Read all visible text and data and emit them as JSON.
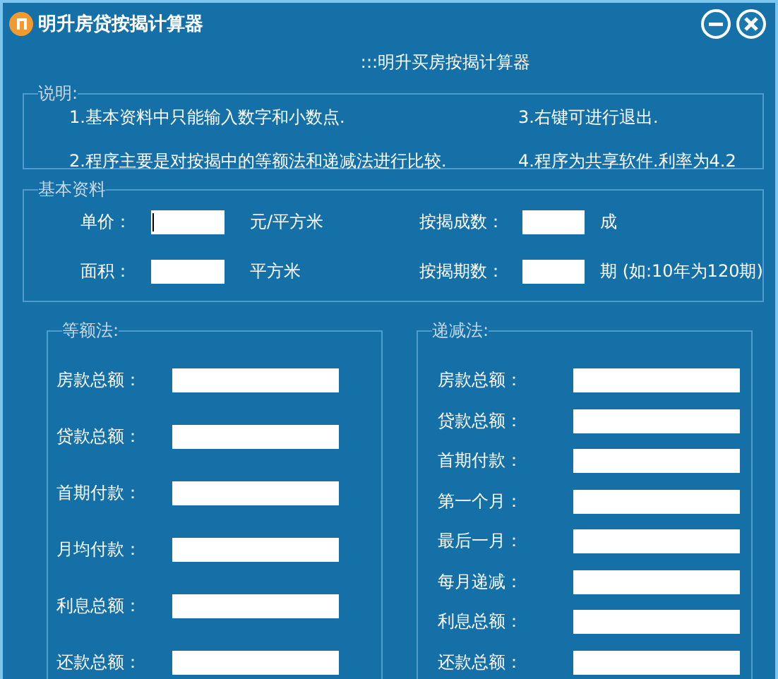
{
  "window": {
    "title": "明升房贷按揭计算器",
    "buttons": [
      {
        "kind": "minimize"
      },
      {
        "kind": "close"
      }
    ]
  },
  "subtitle": ":::明升买房按揭计算器",
  "notes": {
    "legend": "说明:",
    "items": [
      "1.基本资料中只能输入数字和小数点.",
      "3.右键可进行退出.",
      "2.程序主要是对按揭中的等额法和递减法进行比较.",
      "4.程序为共享软件.利率为4.2"
    ]
  },
  "basic": {
    "legend": "基本资料",
    "fields": [
      {
        "label": "单价：",
        "unit": "元/平方米",
        "focused": true
      },
      {
        "label": "按揭成数：",
        "unit": "成",
        "focused": false
      },
      {
        "label": "面积：",
        "unit": "平方米",
        "focused": false
      },
      {
        "label": "按揭期数：",
        "unit": "期 (如:10年为120期)",
        "focused": false
      }
    ]
  },
  "methods": [
    {
      "legend": "等额法:",
      "kind": "wide",
      "rows": [
        "房款总额：",
        "贷款总额：",
        "首期付款：",
        "月均付款：",
        "利息总额：",
        "还款总额："
      ]
    },
    {
      "legend": "递减法:",
      "kind": "dense",
      "rows": [
        "房款总额：",
        "贷款总额：",
        "首期付款：",
        "第一个月：",
        "最后一月：",
        "每月递减：",
        "利息总额：",
        "还款总额："
      ]
    }
  ]
}
